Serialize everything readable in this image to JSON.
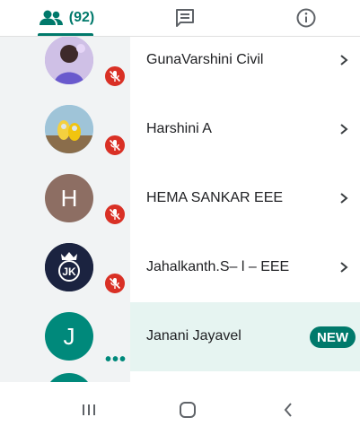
{
  "tabs": {
    "people_count": "(92)",
    "people_icon": "people-icon",
    "chat_icon": "chat-icon",
    "info_icon": "info-icon"
  },
  "colors": {
    "accent": "#00796b",
    "mute": "#d93025",
    "highlight_row": "#e6f4f1",
    "left_strip": "#f1f3f4"
  },
  "participants": [
    {
      "name": "GunaVarshini Civil",
      "avatar": "photo",
      "muted": true
    },
    {
      "name": "Harshini A",
      "avatar": "photo",
      "muted": true
    },
    {
      "name": "HEMA SANKAR EEE",
      "avatar_letter": "H",
      "avatar_color": "#8d6e63",
      "muted": true
    },
    {
      "name": "Jahalkanth.S– l – EEE",
      "avatar_logo": "JK",
      "avatar_color": "#1b2340",
      "muted": true
    },
    {
      "name": "Janani Jayavel",
      "avatar_letter": "J",
      "avatar_color": "#00897b",
      "badge": "NEW",
      "more": "•••"
    }
  ],
  "navbar": {
    "recents_icon": "recents-icon",
    "home_icon": "home-icon",
    "back_icon": "back-icon"
  }
}
